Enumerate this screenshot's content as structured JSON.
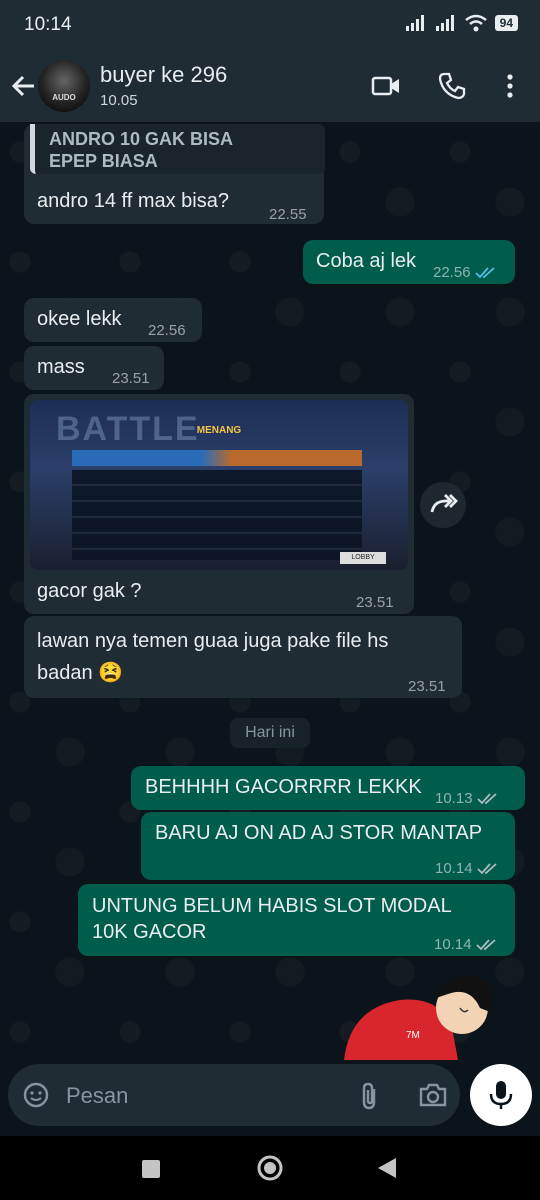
{
  "status": {
    "time": "10:14",
    "battery": "94"
  },
  "header": {
    "contact_name": "buyer ke 296",
    "subtitle": "10.05",
    "avatar_text": "AUDO"
  },
  "messages": [
    {
      "dir": "in",
      "quote": "ANDRO 10 GAK BISA\nEPEP BIASA",
      "text": "andro 14 ff max bisa?",
      "time": "22.55"
    },
    {
      "dir": "out",
      "text": "Coba aj lek",
      "time": "22.56"
    },
    {
      "dir": "in",
      "text": "okee lekk",
      "time": "22.56"
    },
    {
      "dir": "in",
      "text": "mass",
      "time": "23.51"
    },
    {
      "dir": "in",
      "image": "game-result-screenshot",
      "text": "gacor gak ?",
      "time": "23.51"
    },
    {
      "dir": "in",
      "text": "lawan nya temen guaa juga pake file hs\nbadan 😫",
      "time": "23.51"
    },
    {
      "dir": "out",
      "text": "BEHHHH GACORRRR LEKKK",
      "time": "10.13"
    },
    {
      "dir": "out",
      "text": "BARU AJ ON AD AJ STOR MANTAP",
      "time": "10.14"
    },
    {
      "dir": "out",
      "text": "UNTUNG BELUM HABIS SLOT MODAL\n10K GACOR",
      "time": "10.14"
    }
  ],
  "game_image": {
    "title": "MENANG",
    "watermark": "BATTLE",
    "button": "LOBBY"
  },
  "day_separator": "Hari ini",
  "input": {
    "placeholder": "Pesan"
  },
  "colors": {
    "incoming": "#202c33",
    "outgoing": "#005c4b",
    "read_tick": "#53bdeb",
    "header": "#1f2c34"
  }
}
